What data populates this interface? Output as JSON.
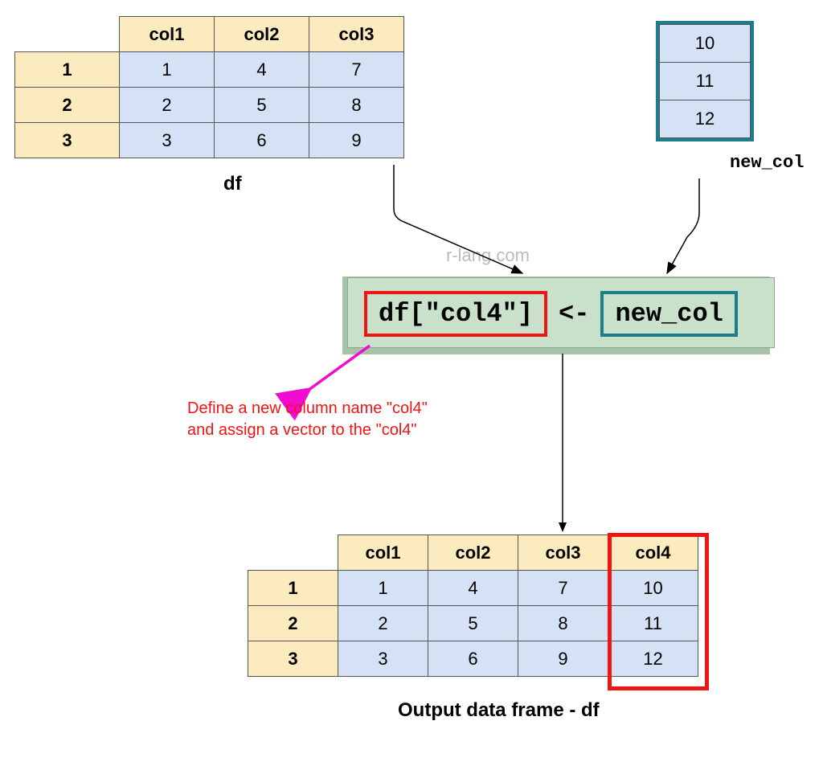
{
  "df": {
    "label": "df",
    "headers": [
      "col1",
      "col2",
      "col3"
    ],
    "rows": [
      {
        "idx": "1",
        "vals": [
          "1",
          "4",
          "7"
        ]
      },
      {
        "idx": "2",
        "vals": [
          "2",
          "5",
          "8"
        ]
      },
      {
        "idx": "3",
        "vals": [
          "3",
          "6",
          "9"
        ]
      }
    ]
  },
  "new_col": {
    "label": "new_col",
    "values": [
      "10",
      "11",
      "12"
    ]
  },
  "watermark": "r-lang.com",
  "code": {
    "lhs": "df[\"col4\"]",
    "assign": "<-",
    "rhs": "new_col"
  },
  "annotation": {
    "line1": "Define a new column name \"col4\"",
    "line2": "and assign a vector to the \"col4\""
  },
  "output": {
    "caption": "Output data frame - df",
    "headers": [
      "col1",
      "col2",
      "col3",
      "col4"
    ],
    "rows": [
      {
        "idx": "1",
        "vals": [
          "1",
          "4",
          "7",
          "10"
        ]
      },
      {
        "idx": "2",
        "vals": [
          "2",
          "5",
          "8",
          "11"
        ]
      },
      {
        "idx": "3",
        "vals": [
          "3",
          "6",
          "9",
          "12"
        ]
      }
    ]
  }
}
